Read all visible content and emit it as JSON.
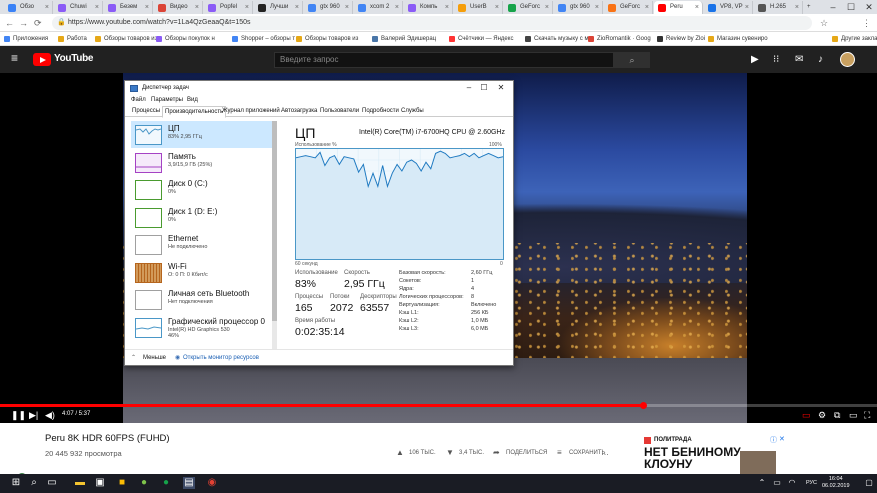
{
  "browser": {
    "tabs": [
      {
        "label": "Обзо",
        "color": "#3b82f6"
      },
      {
        "label": "Chuwi",
        "color": "#8b5cf6"
      },
      {
        "label": "Безем",
        "color": "#8b5cf6"
      },
      {
        "label": "Видео",
        "color": "#db4437"
      },
      {
        "label": "Popfel",
        "color": "#8b5cf6"
      },
      {
        "label": "Лучши",
        "color": "#222222"
      },
      {
        "label": "gtx 960",
        "color": "#4285f4"
      },
      {
        "label": "xcom 2",
        "color": "#4285f4"
      },
      {
        "label": "Компь",
        "color": "#8b5cf6"
      },
      {
        "label": "UserB",
        "color": "#f59e0b"
      },
      {
        "label": "GeForc",
        "color": "#16a34a"
      },
      {
        "label": "gtx 960",
        "color": "#4285f4"
      },
      {
        "label": "GeForc",
        "color": "#f97316"
      },
      {
        "label": "Peru",
        "color": "#ff0000"
      },
      {
        "label": "VP8, VP",
        "color": "#1a73e8"
      },
      {
        "label": "H.265",
        "color": "#555555"
      }
    ],
    "url": "https://www.youtube.com/watch?v=1La4QzGeaaQ&t=150s",
    "bookmarks": [
      {
        "label": "Приложения",
        "color": "#4285f4"
      },
      {
        "label": "Работа",
        "color": "#e6a817"
      },
      {
        "label": "Обзоры товаров из",
        "color": "#e6a817"
      },
      {
        "label": "Обзоры покупок н",
        "color": "#8b5cf6"
      },
      {
        "label": "Shopper – обзоры т",
        "color": "#4285f4"
      },
      {
        "label": "Обзоры товаров из",
        "color": "#e6a817"
      },
      {
        "label": "Валерий Эдишерац",
        "color": "#4a76a8"
      },
      {
        "label": "Счётчики — Яндекс",
        "color": "#ff3333"
      },
      {
        "label": "Скачать музыку с м",
        "color": "#444444"
      },
      {
        "label": "ZioRomantik · Goog",
        "color": "#db4437"
      },
      {
        "label": "Review by Zloi",
        "color": "#333333"
      },
      {
        "label": "Магазин сувениро",
        "color": "#e6a817"
      },
      {
        "label": "Другие закладки",
        "color": "#e6a817"
      }
    ]
  },
  "youtube": {
    "brand": "YouTube",
    "search_placeholder": "Введите запрос",
    "time": "4:07 / 5:37",
    "progress": 0.7329,
    "video_title": "Peru 8K HDR 60FPS (FUHD)",
    "views": "20 445 932 просмотра",
    "likes": "106 ТЫС.",
    "dislikes": "3,4 ТЫС.",
    "share": "ПОДЕЛИТЬСЯ",
    "save": "СОХРАНИТЬ",
    "ad_label": "ПОЛИТРАДА",
    "ad_headline": "НЕТ БЕНИНОМУ КЛОУНУ"
  },
  "taskmgr": {
    "title": "Диспетчер задач",
    "menu": [
      "Файл",
      "Параметры",
      "Вид"
    ],
    "tabs": [
      "Процессы",
      "Производительность",
      "Журнал приложений",
      "Автозагрузка",
      "Пользователи",
      "Подробности",
      "Службы"
    ],
    "sidebar": [
      {
        "name": "ЦП",
        "sub": "83% 2,95 ГГц",
        "sub2": "",
        "color": "#4a97c7"
      },
      {
        "name": "Память",
        "sub": "3,9/15,9 ГБ (25%)",
        "sub2": "",
        "color": "#a542c4"
      },
      {
        "name": "Диск 0 (C:)",
        "sub": "0%",
        "sub2": "",
        "color": "#4a9b2f"
      },
      {
        "name": "Диск 1 (D: E:)",
        "sub": "0%",
        "sub2": "",
        "color": "#4a9b2f"
      },
      {
        "name": "Ethernet",
        "sub": "Не подключено",
        "sub2": "",
        "color": "#a0a0a0"
      },
      {
        "name": "Wi-Fi",
        "sub": "О: 0 П: 0 Кбит/с",
        "sub2": "",
        "color": "#b5651d"
      },
      {
        "name": "Личная сеть Bluetooth",
        "sub": "Нет подключения",
        "sub2": "",
        "color": "#a0a0a0"
      },
      {
        "name": "Графический процессор 0",
        "sub": "Intel(R) HD Graphics 530",
        "sub2": "46%",
        "color": "#4a97c7"
      }
    ],
    "fewer": "Меньше",
    "open_monitor": "Открыть монитор ресурсов",
    "cpu": {
      "heading": "ЦП",
      "model": "Intel(R) Core(TM) i7-6700HQ CPU @ 2.60GHz",
      "util_label": "Использование % ",
      "util_max": "100%",
      "time_label": "60 секунд",
      "zero": "0",
      "usage_label": "Использование",
      "usage": "83%",
      "speed_label": "Скорость",
      "speed": "2,95 ГГц",
      "proc_label": "Процессы",
      "proc": "165",
      "threads_label": "Потоки",
      "threads": "2072",
      "handles_label": "Дескрипторы",
      "handles": "63557",
      "uptime_label": "Время работы",
      "uptime": "0:02:35:14",
      "details": [
        {
          "k": "Базовая скорость:",
          "v": "2,60 ГГц"
        },
        {
          "k": "Сокетов:",
          "v": "1"
        },
        {
          "k": "Ядра:",
          "v": "4"
        },
        {
          "k": "Логических процессоров:",
          "v": "8"
        },
        {
          "k": "Виртуализация:",
          "v": "Включено"
        },
        {
          "k": "Кэш L1:",
          "v": "256 КБ"
        },
        {
          "k": "Кэш L2:",
          "v": "1,0 МБ"
        },
        {
          "k": "Кэш L3:",
          "v": "6,0 МБ"
        }
      ],
      "graph": [
        92,
        93,
        94,
        93,
        92,
        97,
        85,
        92,
        94,
        86,
        93,
        92,
        91,
        79,
        86,
        66,
        78,
        66,
        85,
        66,
        78,
        86,
        80,
        88,
        90,
        87,
        80,
        88,
        82,
        96,
        98,
        96,
        92,
        93,
        94,
        96,
        93,
        96,
        92,
        94,
        96,
        94,
        92,
        93
      ]
    }
  },
  "taskbar": {
    "lang": "РУС",
    "time": "16:04",
    "date": "06.02.2019"
  }
}
